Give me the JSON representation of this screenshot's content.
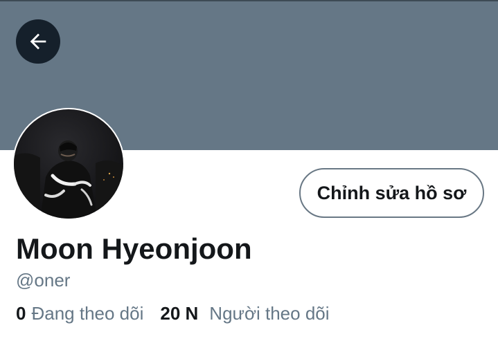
{
  "profile": {
    "name": "Moon Hyeonjoon",
    "handle": "@oner",
    "edit_button_label": "Chỉnh sửa hồ sơ"
  },
  "stats": {
    "following_count": "0",
    "following_label": "Đang theo dõi",
    "followers_count": "20 N",
    "followers_label": "Người theo dõi"
  },
  "icons": {
    "back": "arrow-left-icon"
  },
  "colors": {
    "banner": "#657786",
    "back_button_bg": "#15202b",
    "text_primary": "#14171a",
    "text_secondary": "#657786",
    "button_border": "#687784"
  }
}
